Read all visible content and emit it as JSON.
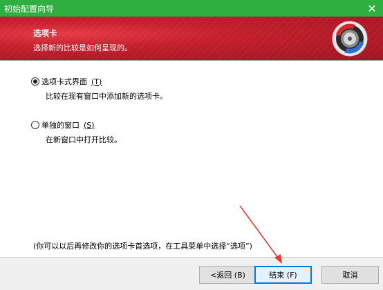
{
  "window": {
    "title": "初始配置向导",
    "close_glyph": "✕"
  },
  "header": {
    "title": "选项卡",
    "subtitle": "选择新的比较是如何呈现的。",
    "accent": "#c41f2c"
  },
  "options": [
    {
      "label": "选项卡式界面",
      "key": "(T)",
      "description": "比较在现有窗口中添加新的选项卡。",
      "selected": true
    },
    {
      "label": "单独的窗口",
      "key": "(S)",
      "description": "在新窗口中打开比较。",
      "selected": false
    }
  ],
  "note": "(你可以以后再修改你的选项卡首选项，在工具菜单中选择“选项”)",
  "buttons": {
    "back": "<返回 (B)",
    "finish": "结束 (F)",
    "cancel": "取消"
  },
  "colors": {
    "titlebar": "#2eaf3f",
    "annotation_arrow": "#e53935"
  }
}
